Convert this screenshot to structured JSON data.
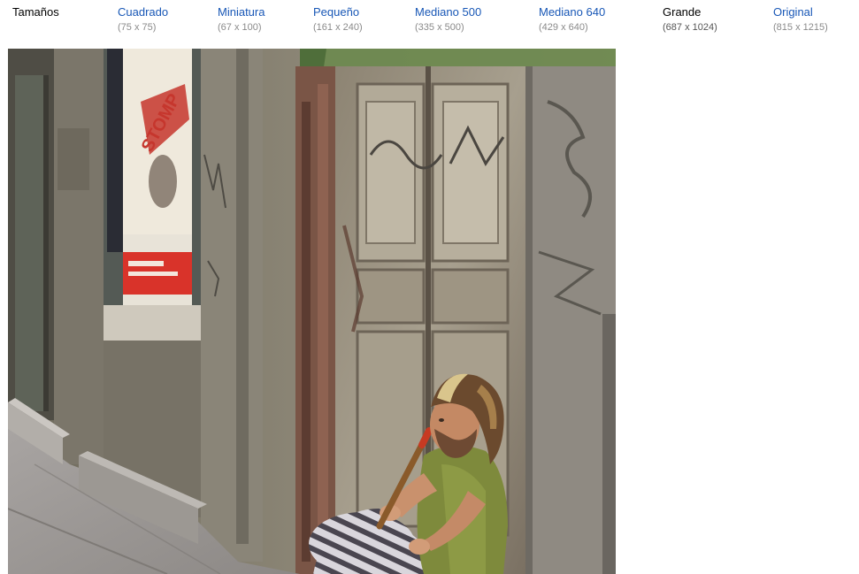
{
  "sizes": {
    "label": "Tamaños",
    "options": [
      {
        "name": "Cuadrado",
        "dims": "(75 x 75)",
        "current": false
      },
      {
        "name": "Miniatura",
        "dims": "(67 x 100)",
        "current": false
      },
      {
        "name": "Pequeño",
        "dims": "(161 x 240)",
        "current": false
      },
      {
        "name": "Mediano 500",
        "dims": "(335 x 500)",
        "current": false
      },
      {
        "name": "Mediano 640",
        "dims": "(429 x 640)",
        "current": false
      },
      {
        "name": "Grande",
        "dims": "(687 x 1024)",
        "current": true
      },
      {
        "name": "Original",
        "dims": "(815 x 1215)",
        "current": false
      }
    ]
  },
  "colors": {
    "link": "#1857b6",
    "current": "#000000",
    "dims": "#8a8a8a"
  },
  "photo": {
    "poster_text": "STOMP"
  }
}
